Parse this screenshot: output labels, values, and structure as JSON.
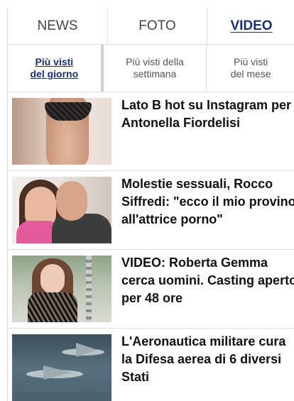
{
  "tabs": [
    {
      "label": "NEWS",
      "active": false
    },
    {
      "label": "FOTO",
      "active": false
    },
    {
      "label": "VIDEO",
      "active": true
    }
  ],
  "subtabs": [
    {
      "label": "Più visti\ndel giorno",
      "active": true
    },
    {
      "label": "Più visti della\nsettimana",
      "active": false
    },
    {
      "label": "Più visti\ndel mese",
      "active": false
    }
  ],
  "items": [
    {
      "title_lines": [
        "Lato B hot su Instagram per",
        "Antonella Fiordelisi"
      ]
    },
    {
      "title_lines": [
        "Molestie sessuali, Rocco",
        "Siffredi: \"ecco il mio provino",
        "all'attrice porno\""
      ]
    },
    {
      "title_lines": [
        "VIDEO: Roberta Gemma",
        "cerca uomini. Casting aperto",
        "per 48 ore"
      ]
    },
    {
      "title_lines": [
        "L'Aeronautica militare cura",
        "la Difesa aerea di 6 diversi",
        "Stati"
      ]
    }
  ],
  "colors": {
    "accent": "#1c2e6e",
    "divider": "#dcdcdc"
  }
}
